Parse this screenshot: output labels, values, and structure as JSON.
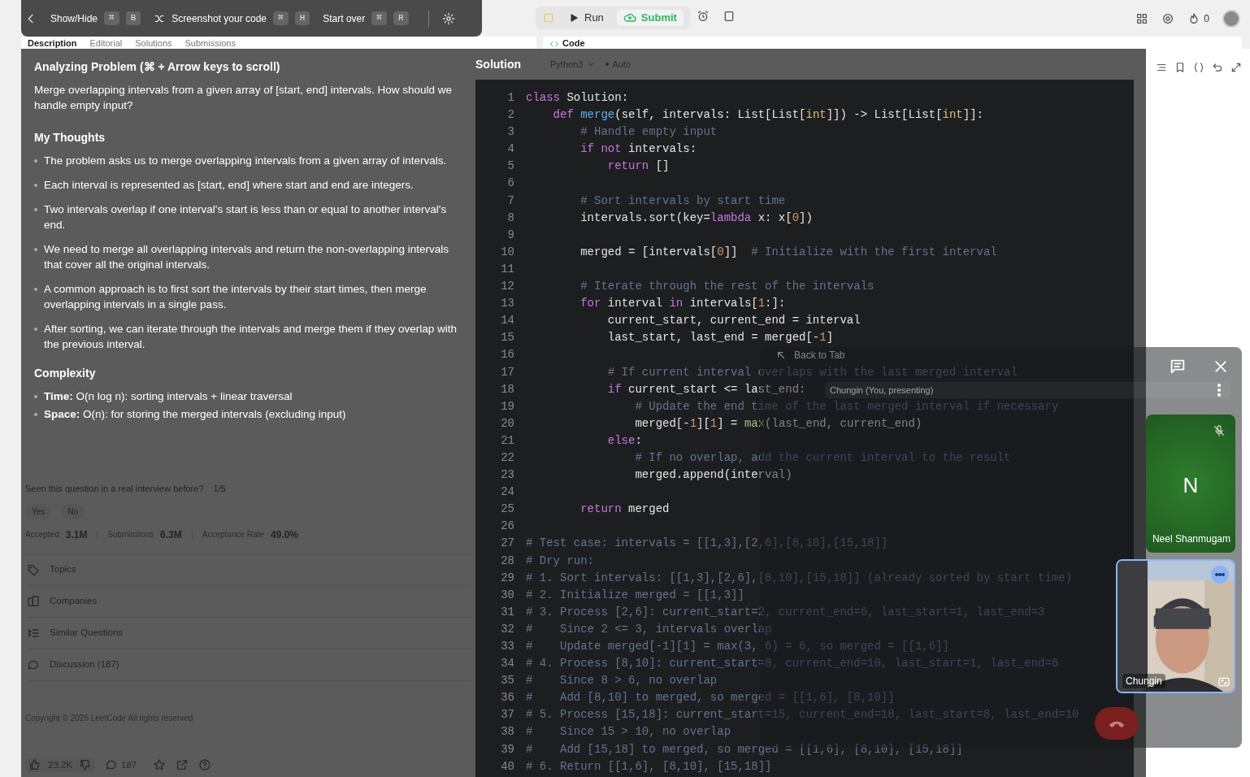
{
  "overlay_toolbar": [
    {
      "label": "Show/Hide",
      "keys": [
        "⌘",
        "B"
      ]
    },
    {
      "label": "Screenshot your code",
      "keys": [
        "⌘",
        "H"
      ]
    },
    {
      "label": "Start over",
      "keys": [
        "⌘",
        "R"
      ]
    }
  ],
  "actions": {
    "run": "Run",
    "submit": "Submit"
  },
  "account": {
    "streak": "0"
  },
  "problem_tabs": [
    {
      "label": "Description",
      "selected": true
    },
    {
      "label": "Editorial",
      "selected": false
    },
    {
      "label": "Solutions",
      "selected": false
    },
    {
      "label": "Submissions",
      "selected": false
    }
  ],
  "code_tab": "Code",
  "analysis": {
    "title": "Analyzing Problem (⌘ + Arrow keys to scroll)",
    "question": "Merge overlapping intervals from a given array of [start, end] intervals. How should we handle empty input?",
    "thoughts_heading": "My Thoughts",
    "thoughts": [
      "The problem asks us to merge overlapping intervals from a given array of intervals.",
      "Each interval is represented as [start, end] where start and end are integers.",
      "Two intervals overlap if one interval's start is less than or equal to another interval's end.",
      "We need to merge all overlapping intervals and return the non-overlapping intervals that cover all the original intervals.",
      "A common approach is to first sort the intervals by their start times, then merge overlapping intervals in a single pass.",
      "After sorting, we can iterate through the intervals and merge them if they overlap with the previous interval."
    ],
    "complexity_heading": "Complexity",
    "complexity": [
      "**Time:** O(n log n): sorting intervals + linear traversal",
      "**Space:** O(n): for storing the merged intervals (excluding input)"
    ]
  },
  "solution": {
    "heading": "Solution",
    "language": "Python3",
    "mode": "Auto",
    "lines": [
      {
        "no": "1",
        "parts": [
          {
            "kind": "keyword",
            "t": "class"
          },
          {
            "kind": "plain",
            "t": " Solution:"
          }
        ]
      },
      {
        "no": "2",
        "parts": [
          {
            "kind": "keyword",
            "t": "    def"
          },
          {
            "kind": "function",
            "t": " merge"
          },
          {
            "kind": "plain",
            "t": "(self, intervals: List[List["
          },
          {
            "kind": "type",
            "t": "int"
          },
          {
            "kind": "plain",
            "t": "]]) -> List[List["
          },
          {
            "kind": "type",
            "t": "int"
          },
          {
            "kind": "plain",
            "t": "]]:"
          }
        ]
      },
      {
        "no": "3",
        "parts": [
          {
            "kind": "comment",
            "t": "        # Handle empty input"
          }
        ]
      },
      {
        "no": "4",
        "parts": [
          {
            "kind": "keyword",
            "t": "        if not"
          },
          {
            "kind": "plain",
            "t": " intervals:"
          }
        ]
      },
      {
        "no": "5",
        "parts": [
          {
            "kind": "keyword",
            "t": "            return"
          },
          {
            "kind": "plain",
            "t": " []"
          }
        ]
      },
      {
        "no": "6"
      },
      {
        "no": "7",
        "parts": [
          {
            "kind": "comment",
            "t": "        # Sort intervals by start time"
          }
        ]
      },
      {
        "no": "8",
        "parts": [
          {
            "kind": "plain",
            "t": "        intervals.sort(key="
          },
          {
            "kind": "keyword",
            "t": "lambda"
          },
          {
            "kind": "plain",
            "t": " x: x["
          },
          {
            "kind": "number",
            "t": "0"
          },
          {
            "kind": "plain",
            "t": "])"
          }
        ]
      },
      {
        "no": "9"
      },
      {
        "no": "10",
        "parts": [
          {
            "kind": "plain",
            "t": "        merged = [intervals["
          },
          {
            "kind": "number",
            "t": "0"
          },
          {
            "kind": "plain",
            "t": "]]"
          },
          {
            "kind": "comment",
            "t": "  # Initialize with the first interval"
          }
        ]
      },
      {
        "no": "11"
      },
      {
        "no": "12",
        "parts": [
          {
            "kind": "comment",
            "t": "        # Iterate through the rest of the intervals"
          }
        ]
      },
      {
        "no": "13",
        "parts": [
          {
            "kind": "keyword",
            "t": "        for"
          },
          {
            "kind": "plain",
            "t": " interval"
          },
          {
            "kind": "keyword",
            "t": " in"
          },
          {
            "kind": "plain",
            "t": " intervals["
          },
          {
            "kind": "number",
            "t": "1"
          },
          {
            "kind": "plain",
            "t": ":]:"
          }
        ]
      },
      {
        "no": "14",
        "parts": [
          {
            "kind": "plain",
            "t": "            current_start, current_end = interval"
          }
        ]
      },
      {
        "no": "15",
        "parts": [
          {
            "kind": "plain",
            "t": "            last_start, last_end = merged[-"
          },
          {
            "kind": "number",
            "t": "1"
          },
          {
            "kind": "plain",
            "t": "]"
          }
        ]
      },
      {
        "no": "16"
      },
      {
        "no": "17",
        "parts": [
          {
            "kind": "comment",
            "t": "            # If current interval overlaps with the last merged interval"
          }
        ]
      },
      {
        "no": "18",
        "parts": [
          {
            "kind": "keyword",
            "t": "            if"
          },
          {
            "kind": "plain",
            "t": " current_start <= last_end:"
          }
        ]
      },
      {
        "no": "19",
        "parts": [
          {
            "kind": "comment",
            "t": "                # Update the end time of the last merged interval if necessary"
          }
        ]
      },
      {
        "no": "20",
        "parts": [
          {
            "kind": "plain",
            "t": "                merged[-"
          },
          {
            "kind": "number",
            "t": "1"
          },
          {
            "kind": "plain",
            "t": "]["
          },
          {
            "kind": "number",
            "t": "1"
          },
          {
            "kind": "plain",
            "t": "] = "
          },
          {
            "kind": "builtin",
            "t": "max"
          },
          {
            "kind": "plain",
            "t": "(last_end, current_end)"
          }
        ]
      },
      {
        "no": "21",
        "parts": [
          {
            "kind": "keyword",
            "t": "            else"
          },
          {
            "kind": "plain",
            "t": ":"
          }
        ]
      },
      {
        "no": "22",
        "parts": [
          {
            "kind": "comment",
            "t": "                # If no overlap, add the current interval to the result"
          }
        ]
      },
      {
        "no": "23",
        "parts": [
          {
            "kind": "plain",
            "t": "                merged.append(interval)"
          }
        ]
      },
      {
        "no": "24"
      },
      {
        "no": "25",
        "parts": [
          {
            "kind": "keyword",
            "t": "        return"
          },
          {
            "kind": "plain",
            "t": " merged"
          }
        ]
      },
      {
        "no": "26"
      },
      {
        "no": "27",
        "parts": [
          {
            "kind": "comment",
            "t": "# Test case: intervals = [[1,3],[2,6],[8,10],[15,18]]"
          }
        ]
      },
      {
        "no": "28",
        "parts": [
          {
            "kind": "comment",
            "t": "# Dry run:"
          }
        ]
      },
      {
        "no": "29",
        "parts": [
          {
            "kind": "comment",
            "t": "# 1. Sort intervals: [[1,3],[2,6],[8,10],[15,18]] (already sorted by start time)"
          }
        ]
      },
      {
        "no": "30",
        "parts": [
          {
            "kind": "comment",
            "t": "# 2. Initialize merged = [[1,3]]"
          }
        ]
      },
      {
        "no": "31",
        "parts": [
          {
            "kind": "comment",
            "t": "# 3. Process [2,6]: current_start=2, current_end=6, last_start=1, last_end=3"
          }
        ]
      },
      {
        "no": "32",
        "parts": [
          {
            "kind": "comment",
            "t": "#    Since 2 <= 3, intervals overlap"
          }
        ]
      },
      {
        "no": "33",
        "parts": [
          {
            "kind": "comment",
            "t": "#    Update merged[-1][1] = max(3, 6) = 6, so merged = [[1,6]]"
          }
        ]
      },
      {
        "no": "34",
        "parts": [
          {
            "kind": "comment",
            "t": "# 4. Process [8,10]: current_start=8, current_end=10, last_start=1, last_end=6"
          }
        ]
      },
      {
        "no": "35",
        "parts": [
          {
            "kind": "comment",
            "t": "#    Since 8 > 6, no overlap"
          }
        ]
      },
      {
        "no": "36",
        "parts": [
          {
            "kind": "comment",
            "t": "#    Add [8,10] to merged, so merged = [[1,6], [8,10]]"
          }
        ]
      },
      {
        "no": "37",
        "parts": [
          {
            "kind": "comment",
            "t": "# 5. Process [15,18]: current_start=15, current_end=18, last_start=8, last_end=10"
          }
        ]
      },
      {
        "no": "38",
        "parts": [
          {
            "kind": "comment",
            "t": "#    Since 15 > 10, no overlap"
          }
        ]
      },
      {
        "no": "39",
        "parts": [
          {
            "kind": "comment",
            "t": "#    Add [15,18] to merged, so merged = [[1,6], [8,10], [15,18]]"
          }
        ]
      },
      {
        "no": "40",
        "parts": [
          {
            "kind": "comment",
            "t": "# 6. Return [[1,6], [8,10], [15,18]]"
          }
        ]
      }
    ]
  },
  "problem_footer": {
    "interview_question": "Seen this question in a real interview before?",
    "interview_count": "1/5",
    "answers": [
      "Yes",
      "No"
    ],
    "stats": [
      {
        "label": "Accepted",
        "value": "3.1M"
      },
      {
        "label": "Submissions",
        "value": "6.3M"
      },
      {
        "label": "Acceptance Rate",
        "value": "49.0%"
      }
    ],
    "sections": [
      {
        "kind": "tag",
        "label": "Topics"
      },
      {
        "kind": "companies",
        "label": "Companies"
      },
      {
        "kind": "list",
        "label": "Similar Questions"
      },
      {
        "kind": "discussion",
        "label": "Discussion (187)"
      }
    ],
    "copyright": "Copyright © 2025 LeetCode All rights reserved",
    "likes": "23.2K",
    "comments": "187"
  },
  "meet": {
    "back": "Back to Tab",
    "presenter": "Chungin (You, presenting)",
    "participants": [
      {
        "kind": "avatar",
        "initial": "N",
        "name": "Neel Shanmugam",
        "muted": true
      },
      {
        "kind": "camera",
        "name": "Chungin",
        "muted": false
      }
    ]
  }
}
